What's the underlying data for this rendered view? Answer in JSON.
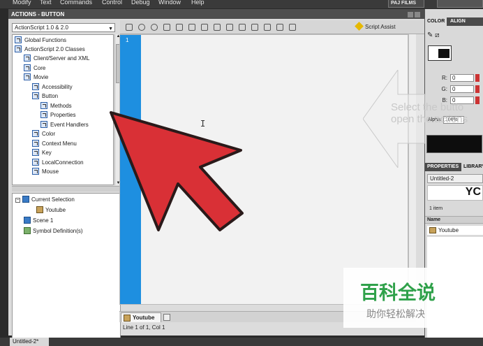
{
  "menu": {
    "items": [
      "Modify",
      "Text",
      "Commands",
      "Control",
      "Debug",
      "Window",
      "Help"
    ],
    "profile": "PAJ FILMS"
  },
  "actions_panel": {
    "title": "ACTIONS - BUTTON",
    "version_select": "ActionScript 1.0 & 2.0",
    "tree": [
      {
        "label": "Global Functions",
        "icon": "book-icon"
      },
      {
        "label": "ActionScript 2.0 Classes",
        "icon": "book-icon"
      },
      {
        "label": "Client/Server and XML",
        "icon": "book-icon"
      },
      {
        "label": "Core",
        "icon": "book-icon"
      },
      {
        "label": "Movie",
        "icon": "book-open-icon"
      },
      {
        "label": "Accessibility",
        "icon": "book-icon"
      },
      {
        "label": "Button",
        "icon": "book-open-icon"
      },
      {
        "label": "Methods",
        "icon": "book-icon"
      },
      {
        "label": "Properties",
        "icon": "book-icon"
      },
      {
        "label": "Event Handlers",
        "icon": "book-icon"
      },
      {
        "label": "Color",
        "icon": "book-icon"
      },
      {
        "label": "Context Menu",
        "icon": "book-icon"
      },
      {
        "label": "Key",
        "icon": "book-icon"
      },
      {
        "label": "LocalConnection",
        "icon": "book-icon"
      },
      {
        "label": "Mouse",
        "icon": "book-icon"
      }
    ],
    "script_nav": [
      {
        "label": "Current Selection"
      },
      {
        "label": "Youtube"
      },
      {
        "label": "Scene 1"
      },
      {
        "label": "Symbol Definition(s)"
      }
    ],
    "script_assist": "Script Assist",
    "line_number": "1",
    "tab_label": "Youtube",
    "status": "Line 1 of 1, Col 1"
  },
  "color_panel": {
    "tabs": [
      "COLOR",
      "ALIGN"
    ],
    "r_label": "R:",
    "r_value": "0",
    "g_label": "G:",
    "g_value": "0",
    "b_label": "B:",
    "b_value": "0",
    "alpha_label": "Alpha:",
    "alpha_value": "100%"
  },
  "library_panel": {
    "tabs": [
      "PROPERTIES",
      "LIBRARY"
    ],
    "document": "Untitled-2",
    "preview_text": "YC",
    "count": "1 item",
    "name_header": "Name",
    "item": "Youtube"
  },
  "document_tab": "Untitled-2*",
  "hint_text": {
    "line1": "Select the butto",
    "line2": "open the actions"
  },
  "watermark": {
    "title": "百科全说",
    "subtitle": "助你轻松解决"
  },
  "colors": {
    "gutter": "#1e8fe0",
    "arrow": "#d93036",
    "brand": "#2fa14a"
  }
}
